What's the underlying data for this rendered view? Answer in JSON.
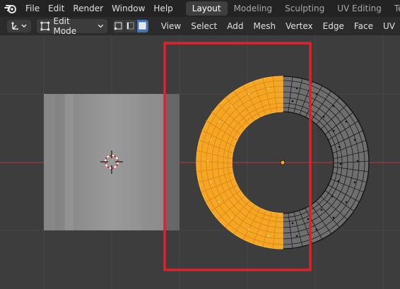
{
  "topbar": {
    "logo_icon": "blender-logo-icon",
    "menus": [
      "File",
      "Edit",
      "Render",
      "Window",
      "Help"
    ],
    "workspaces": [
      "Layout",
      "Modeling",
      "Sculpting",
      "UV Editing",
      "Tex"
    ],
    "active_workspace": "Layout"
  },
  "header": {
    "editor_type_icon": "transform-gizmo-icon",
    "mode_label": "Edit Mode",
    "select_modes": [
      "vertex-select-icon",
      "edge-select-icon",
      "face-select-icon"
    ],
    "active_select_mode": "face-select-icon",
    "menus": [
      "View",
      "Select",
      "Add",
      "Mesh",
      "Vertex",
      "Edge",
      "Face",
      "UV"
    ]
  },
  "colors": {
    "selected": "#f5a623",
    "highlight_box": "#e0202a",
    "x_axis": "#a83a3a",
    "background": "#3d3d3d"
  }
}
